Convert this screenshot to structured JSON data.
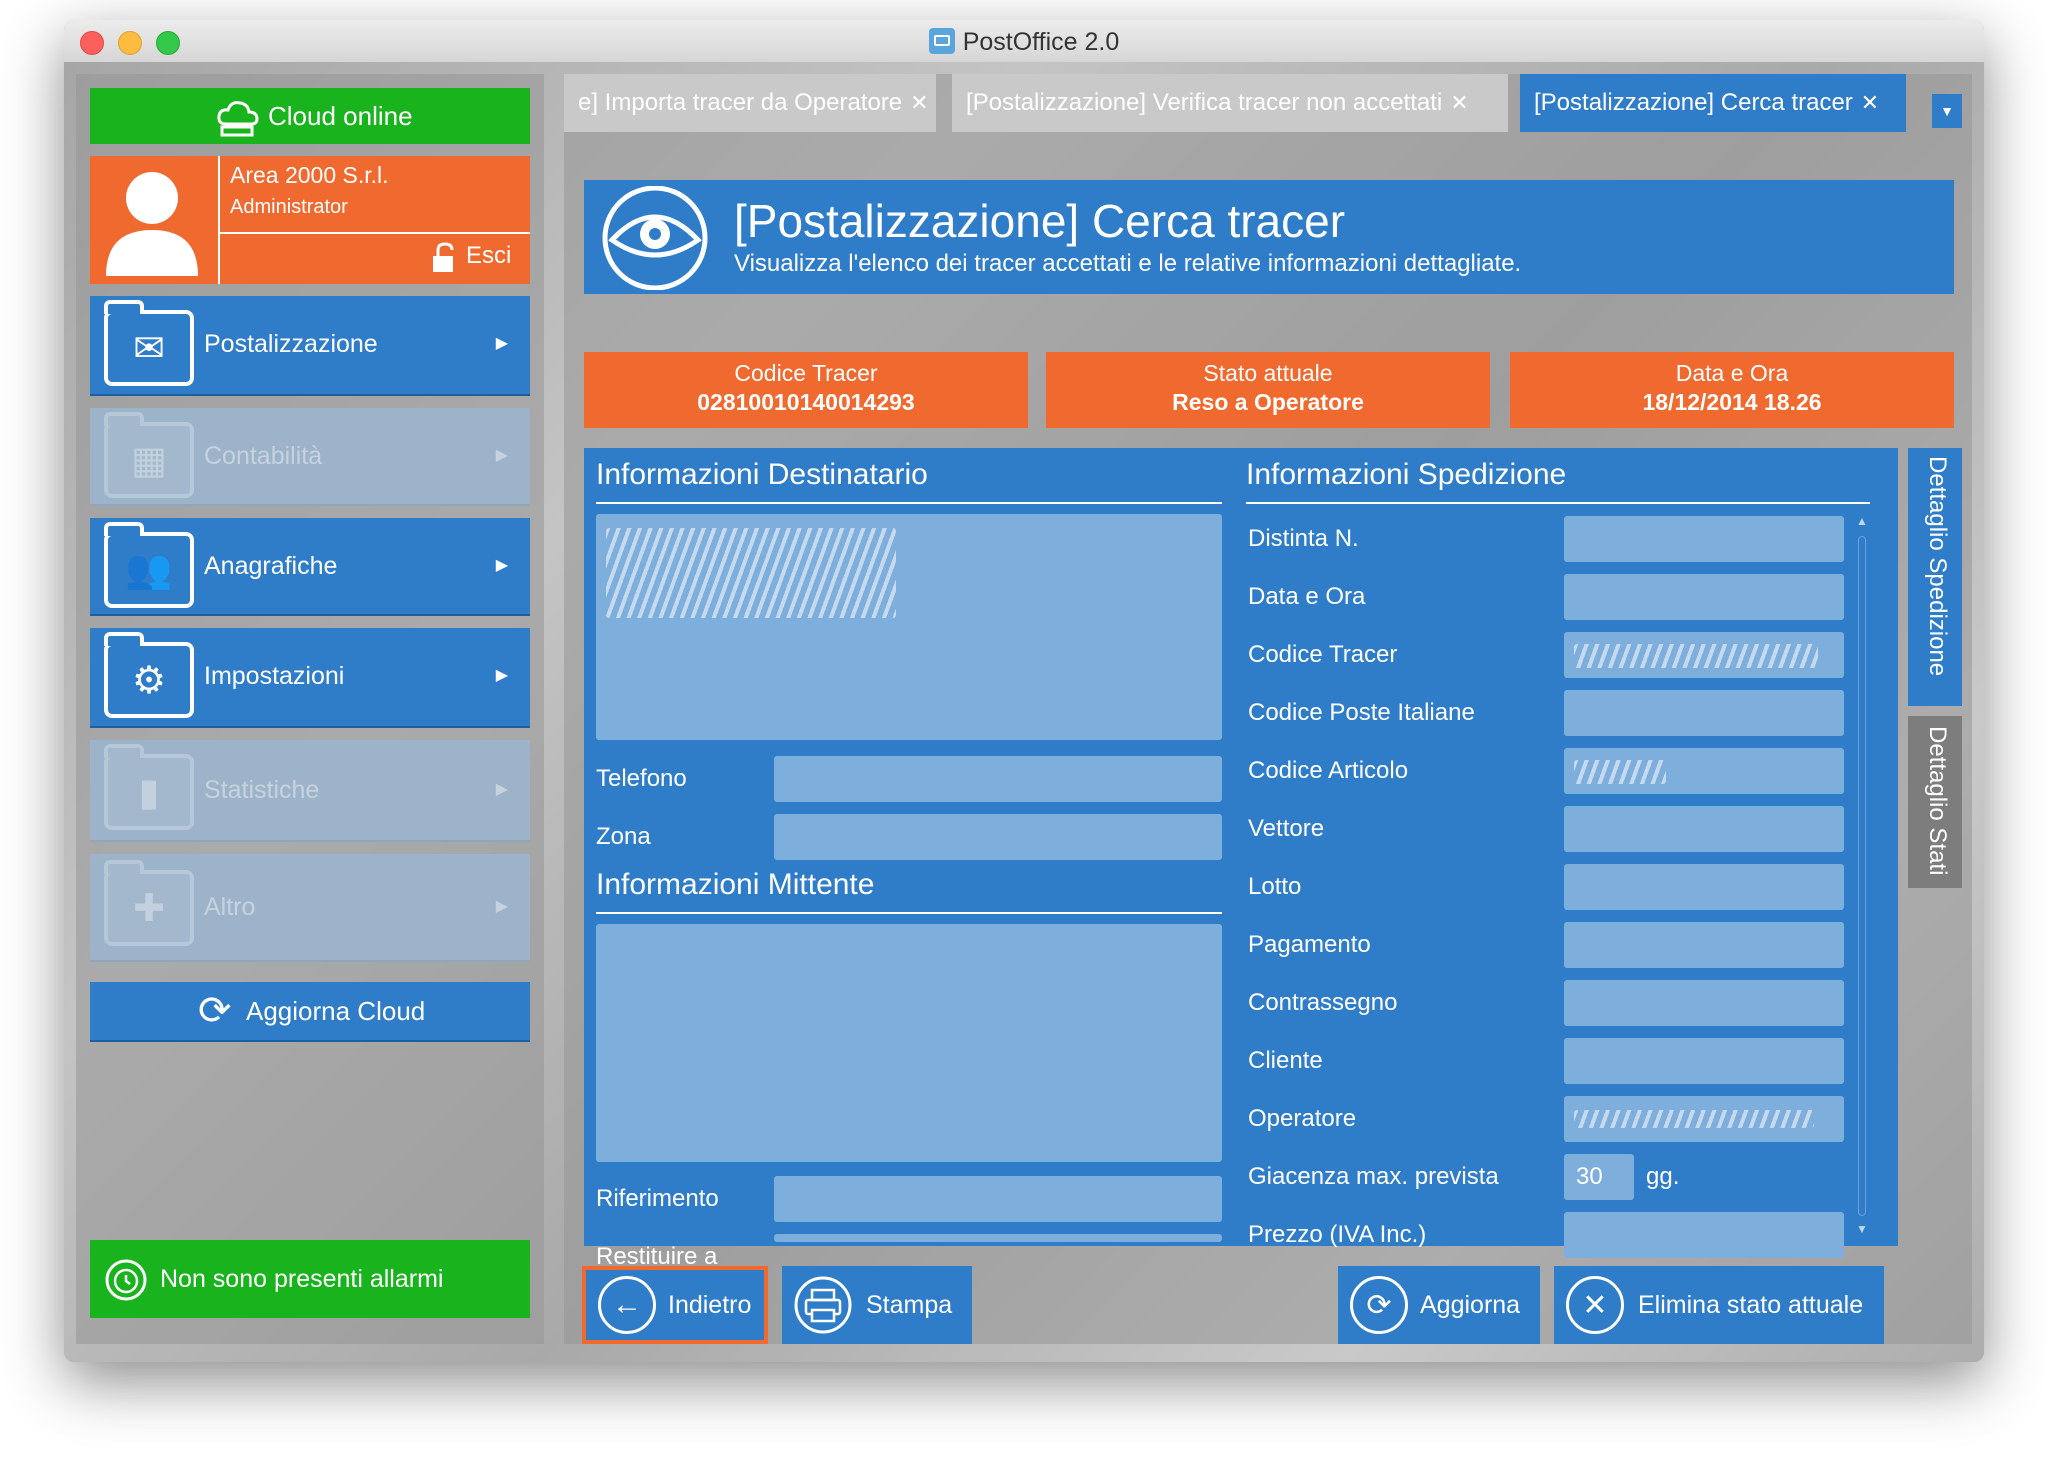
{
  "window": {
    "title": "PostOffice 2.0"
  },
  "sidebar": {
    "cloud_status": "Cloud online",
    "user": {
      "company": "Area 2000 S.r.l.",
      "role": "Administrator",
      "logout": "Esci"
    },
    "items": [
      {
        "label": "Postalizzazione",
        "icon": "envelope-box-icon",
        "enabled": true
      },
      {
        "label": "Contabilità",
        "icon": "calculator-icon",
        "enabled": false
      },
      {
        "label": "Anagrafiche",
        "icon": "users-icon",
        "enabled": true
      },
      {
        "label": "Impostazioni",
        "icon": "gear-icon",
        "enabled": true
      },
      {
        "label": "Statistiche",
        "icon": "bar-chart-icon",
        "enabled": false
      },
      {
        "label": "Altro",
        "icon": "puzzle-icon",
        "enabled": false
      }
    ],
    "refresh_cloud": "Aggiorna Cloud",
    "alarms": "Non sono presenti allarmi"
  },
  "tabs": [
    {
      "label": "e] Importa tracer da Operatore",
      "active": false
    },
    {
      "label": "[Postalizzazione] Verifica tracer non accettati",
      "active": false
    },
    {
      "label": "[Postalizzazione] Cerca tracer",
      "active": true
    }
  ],
  "header": {
    "title": "[Postalizzazione] Cerca tracer",
    "subtitle": "Visualizza l'elenco dei tracer accettati e le relative informazioni dettagliate."
  },
  "status_boxes": [
    {
      "label": "Codice Tracer",
      "value": "02810010140014293"
    },
    {
      "label": "Stato attuale",
      "value": "Reso a Operatore"
    },
    {
      "label": "Data e Ora",
      "value": "18/12/2014 18.26"
    }
  ],
  "recipient": {
    "title": "Informazioni Destinatario",
    "phone_label": "Telefono",
    "zone_label": "Zona"
  },
  "sender": {
    "title": "Informazioni Mittente",
    "reference_label": "Riferimento",
    "return_label": "Restituire a"
  },
  "shipment": {
    "title": "Informazioni Spedizione",
    "fields": [
      {
        "label": "Distinta N.",
        "value": ""
      },
      {
        "label": "Data e Ora",
        "value": ""
      },
      {
        "label": "Codice Tracer",
        "value": ""
      },
      {
        "label": "Codice Poste Italiane",
        "value": ""
      },
      {
        "label": "Codice Articolo",
        "value": ""
      },
      {
        "label": "Vettore",
        "value": ""
      },
      {
        "label": "Lotto",
        "value": ""
      },
      {
        "label": "Pagamento",
        "value": ""
      },
      {
        "label": "Contrassegno",
        "value": ""
      },
      {
        "label": "Cliente",
        "value": ""
      },
      {
        "label": "Operatore",
        "value": ""
      },
      {
        "label": "Giacenza max. prevista",
        "value": "30",
        "unit": "gg."
      },
      {
        "label": "Prezzo (IVA Inc.)",
        "value": ""
      }
    ]
  },
  "side_tabs": {
    "detail_shipment": "Dettaglio Spedizione",
    "detail_states": "Dettaglio Stati"
  },
  "actions": {
    "back": "Indietro",
    "print": "Stampa",
    "refresh": "Aggiorna",
    "delete_state": "Elimina stato attuale"
  },
  "colors": {
    "blue": "#2f7dc8",
    "orange": "#f06a30",
    "green": "#19b31d"
  }
}
